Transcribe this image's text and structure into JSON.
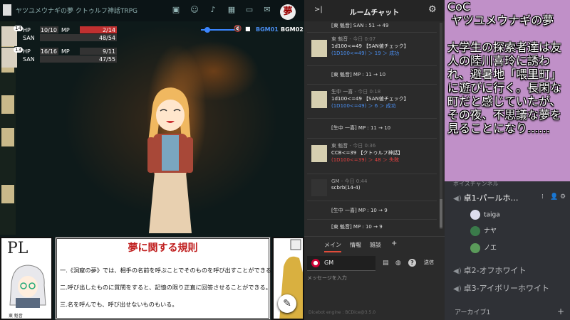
{
  "game": {
    "room_title": "ヤツユメウナギの夢 クトゥルフ神話TRPG",
    "toolbar_icons": [
      "image-icon",
      "face-icon",
      "music-icon",
      "table-icon",
      "screen-icon",
      "note-icon"
    ],
    "settings_avatar": "夢",
    "stats": [
      {
        "num": "14",
        "hp_label": "HP",
        "hp": "10/10",
        "mp_label": "MP",
        "mp": "2/14",
        "mp_color": "#c03030",
        "san_label": "SAN",
        "san": "48/54"
      },
      {
        "num": "13",
        "hp_label": "HP",
        "hp": "16/16",
        "mp_label": "MP",
        "mp": "9/11",
        "mp_color": "#333333",
        "san_label": "SAN",
        "san": "47/55"
      }
    ],
    "bgm": {
      "b1": "BGM01",
      "b2": "BGM02",
      "volume": 0.2
    },
    "pl_card": {
      "label": "PL",
      "name": "東 魁音"
    },
    "rules": {
      "title": "夢に関する規則",
      "lines": [
        "一.《洞窟の夢》では、相手の名前を呼ぶことでそのものを呼び出すことができる。",
        "二.呼び出したものに質問をすると、記憶の限り正直に回答させることができる。",
        "三.名を呼んでも、呼び出せないものもいる。"
      ]
    }
  },
  "chat": {
    "title": "ルームチャット",
    "top_line": "[東 魁音] SAN : 51 → 49",
    "messages": [
      {
        "who": "東 魁音",
        "time": "今日 0:07",
        "cmd": "1d100<=49 【SAN値チェック】",
        "res": "(1D100<=49) ＞ 19 ＞ 成功",
        "fail": false
      },
      {
        "plain": "[東 魁音] MP : 11 → 10"
      },
      {
        "who": "生中 一喜",
        "time": "今日 0:18",
        "cmd": "1d100<=49 【SAN値チェック】",
        "res": "(1D100<=49) ＞ 6 ＞ 成功",
        "fail": false
      },
      {
        "plain": "[生中 一喜] MP : 11 → 10"
      },
      {
        "who": "東 魁音",
        "time": "今日 0:36",
        "cmd": "CCB<=39 【クトゥルフ神話】",
        "res": "(1D100<=39) ＞ 48 ＞ 失敗",
        "fail": true
      },
      {
        "who": "GM",
        "time": "今日 0:44",
        "cmd": "scbrb(14-4)",
        "res": "",
        "fail": false
      },
      {
        "plain": "[生中 一喜] MP : 10 → 9"
      },
      {
        "plain": "[東 魁音] MP : 10 → 9"
      }
    ],
    "tabs": [
      "メイン",
      "情報",
      "雑談",
      "+"
    ],
    "name_value": "GM",
    "send_label": "送信",
    "placeholder": "メッセージを入力",
    "engine": "Dicebot engine : BCDice@3.5.0"
  },
  "story": {
    "text": "CoC\n ヤツユメウナギの夢\n\n大学生の探索者達は友人の陸川喜玲に誘われ、避暑地「喂里町」に遊びに行く。長閑な町だと感じていたが、その夜、不思議な夢を見ることになり……"
  },
  "discord": {
    "category": "ボイスチャンネル",
    "channels": [
      {
        "name": "卓1-パールホ…",
        "active": true
      },
      {
        "name": "卓2-オフホワイト",
        "active": false
      },
      {
        "name": "卓3-アイボリーホワイト",
        "active": false
      }
    ],
    "members": [
      "taiga",
      "ナヤ",
      "ノエ"
    ],
    "archive": "アーカイブ1"
  }
}
